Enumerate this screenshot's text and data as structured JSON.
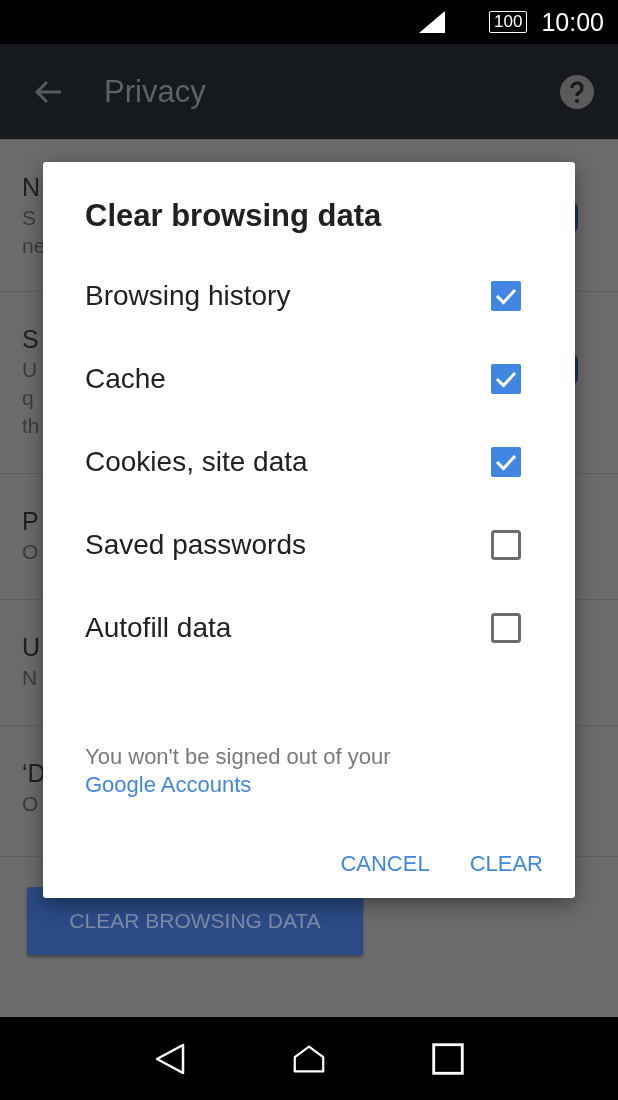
{
  "status_bar": {
    "battery": "100",
    "time": "10:00"
  },
  "app_bar": {
    "title": "Privacy"
  },
  "settings": [
    {
      "title": "N",
      "lines": [
        "S",
        "ne"
      ],
      "toggle": true
    },
    {
      "title": "S",
      "lines": [
        "U",
        "q",
        "th"
      ],
      "toggle": true
    },
    {
      "title": "P",
      "lines": [
        "O"
      ]
    },
    {
      "title": "U",
      "lines": [
        "N"
      ]
    },
    {
      "title": "‘D",
      "lines": [
        "O"
      ]
    }
  ],
  "clear_button": "CLEAR BROWSING DATA",
  "dialog": {
    "title": "Clear browsing data",
    "options": [
      {
        "label": "Browsing history",
        "checked": true
      },
      {
        "label": "Cache",
        "checked": true
      },
      {
        "label": "Cookies, site data",
        "checked": true
      },
      {
        "label": "Saved passwords",
        "checked": false
      },
      {
        "label": "Autofill data",
        "checked": false
      }
    ],
    "note": "You won't be signed out of your",
    "note_link": "Google Accounts",
    "buttons": [
      "CANCEL",
      "CLEAR"
    ]
  }
}
